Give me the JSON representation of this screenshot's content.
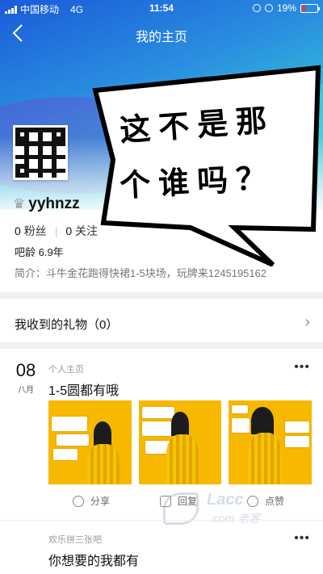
{
  "status_bar": {
    "carrier": "中国移动",
    "network": "4G",
    "time": "11:54",
    "battery": "19%"
  },
  "nav": {
    "back_icon": "chevron-left-icon",
    "title": "我的主页"
  },
  "overlay": {
    "line1": "这不是那",
    "line2": "个谁吗？"
  },
  "profile": {
    "username": "yyhnzz",
    "fans_count": "0",
    "fans_label": "粉丝",
    "follow_count": "0",
    "follow_label": "关注",
    "age": "吧龄 6.9年",
    "bio": "简介：斗牛金花跑得快裙1-5块场，玩牌来1245195162"
  },
  "gifts": {
    "label": "我收到的礼物（0）"
  },
  "post1": {
    "day": "08",
    "month": "八月",
    "source": "个人主页",
    "title": "1-5圆都有哦",
    "actions": {
      "share": "分享",
      "reply": "回复",
      "like": "点赞"
    }
  },
  "watermark": {
    "brand": "Lacc",
    "sub": ".com 老客"
  },
  "post2": {
    "source": "欢乐拼三张吧",
    "title": "你想要的我都有"
  },
  "colors": {
    "banner_start": "#1a5bd8",
    "banner_end": "#7ed8e6",
    "thumb_bg": "#f7b800",
    "battery_low": "#e33"
  }
}
